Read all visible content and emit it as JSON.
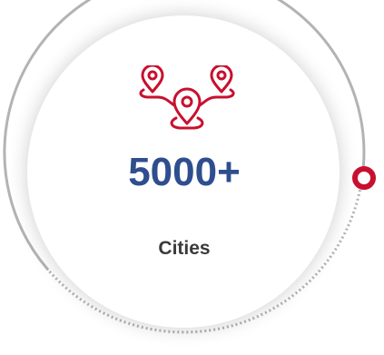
{
  "stat": {
    "value": "5000+",
    "label": "Cities"
  },
  "icon": {
    "name": "map-pins-icon"
  },
  "colors": {
    "value_text": "#2e4e8f",
    "label_text": "#3a3a3a",
    "accent": "#c8102e",
    "ring": "#b3b3b3"
  }
}
